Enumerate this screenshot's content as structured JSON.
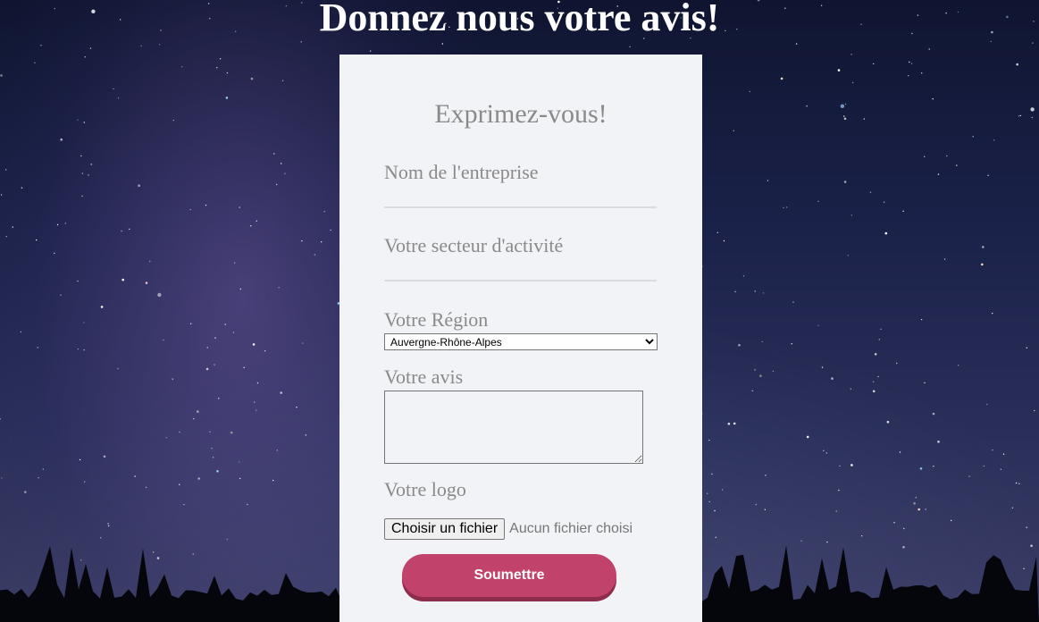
{
  "page": {
    "title": "Donnez nous votre avis!"
  },
  "form": {
    "heading": "Exprimez-vous!",
    "company_name_label": "Nom de l'entreprise",
    "company_name_value": "",
    "sector_label": "Votre secteur d'activité",
    "sector_value": "",
    "region_label": "Votre Région",
    "region_selected": "Auvergne-Rhône-Alpes",
    "opinion_label": "Votre avis",
    "opinion_value": "",
    "logo_label": "Votre logo",
    "file_button_label": "Choisir un fichier",
    "file_status": "Aucun fichier choisi",
    "submit_label": "Soumettre"
  },
  "colors": {
    "card_background": "#f2f3f7",
    "label_text": "#8a8a8a",
    "submit_button": "#c1426a",
    "submit_button_shadow": "#8e2c4c",
    "sky": "#1a2148"
  },
  "background": {
    "description_icon": "starry-night-sky"
  }
}
